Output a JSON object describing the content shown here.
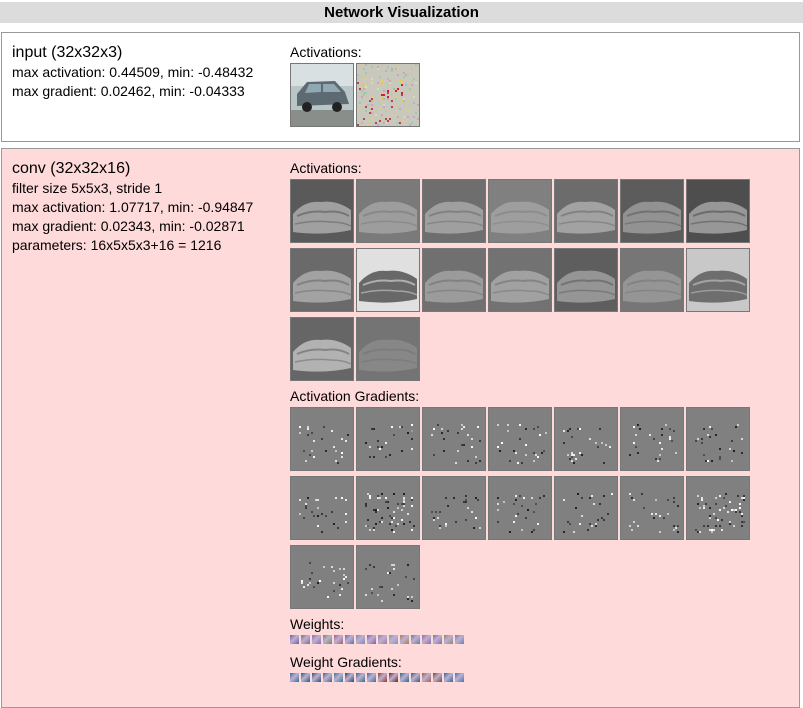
{
  "page_title": "Network Visualization",
  "layers": {
    "input": {
      "name": "input (32x32x3)",
      "max_activation": "max activation: 0.44509, min: -0.48432",
      "max_gradient": "max gradient: 0.02462, min: -0.04333",
      "activations_label": "Activations:",
      "images": [
        {
          "icon": "car-photo-thumbnail"
        },
        {
          "icon": "gradient-noise-thumbnail"
        }
      ]
    },
    "conv": {
      "name": "conv (32x32x16)",
      "filter": "filter size 5x5x3, stride 1",
      "max_activation": "max activation: 1.07717, min: -0.94847",
      "max_gradient": "max gradient: 0.02343, min: -0.02871",
      "parameters": "parameters: 16x5x5x3+16 = 1216",
      "activations_label": "Activations:",
      "activation_gradients_label": "Activation Gradients:",
      "weights_label": "Weights:",
      "weight_gradients_label": "Weight Gradients:",
      "activation_tone": [
        {
          "bg": "#5a5a5a",
          "fg": "#b8b8b8"
        },
        {
          "bg": "#7a7a7a",
          "fg": "#aaaaaa"
        },
        {
          "bg": "#6e6e6e",
          "fg": "#b0b0b0"
        },
        {
          "bg": "#808080",
          "fg": "#a8a8a8"
        },
        {
          "bg": "#6c6c6c",
          "fg": "#b4b4b4"
        },
        {
          "bg": "#5c5c5c",
          "fg": "#a4a4a4"
        },
        {
          "bg": "#4e4e4e",
          "fg": "#b0b0b0"
        },
        {
          "bg": "#6a6a6a",
          "fg": "#b6b6b6"
        },
        {
          "bg": "#e0e0e0",
          "fg": "#404040"
        },
        {
          "bg": "#707070",
          "fg": "#aaaaaa"
        },
        {
          "bg": "#727272",
          "fg": "#b2b2b2"
        },
        {
          "bg": "#5e5e5e",
          "fg": "#a8a8a8"
        },
        {
          "bg": "#767676",
          "fg": "#a0a0a0"
        },
        {
          "bg": "#c8c8c8",
          "fg": "#505050"
        },
        {
          "bg": "#666666",
          "fg": "#cccccc"
        },
        {
          "bg": "#747474",
          "fg": "#8e8e8e"
        }
      ],
      "weight_colors": [
        "#6d5fa0",
        "#7d6e8a",
        "#8a6fb0",
        "#6f8a60",
        "#a06080",
        "#5f6fb0",
        "#7a8ab0",
        "#8060a0",
        "#9a7fa0",
        "#7f9ab0",
        "#a08060",
        "#6080a0",
        "#906fa0",
        "#7a70b0",
        "#8a8a70",
        "#6e7fb0"
      ],
      "weight_gradient_colors": [
        "#2e6f9a",
        "#1f5f80",
        "#305070",
        "#3a6a8a",
        "#2f7aa0",
        "#204a6a",
        "#306a90",
        "#3070a0",
        "#8a3a30",
        "#5a2a2a",
        "#2a6a8a",
        "#3a5a7a",
        "#a06050",
        "#7a4a3a",
        "#2a6a9a",
        "#3a7ab0"
      ]
    }
  }
}
